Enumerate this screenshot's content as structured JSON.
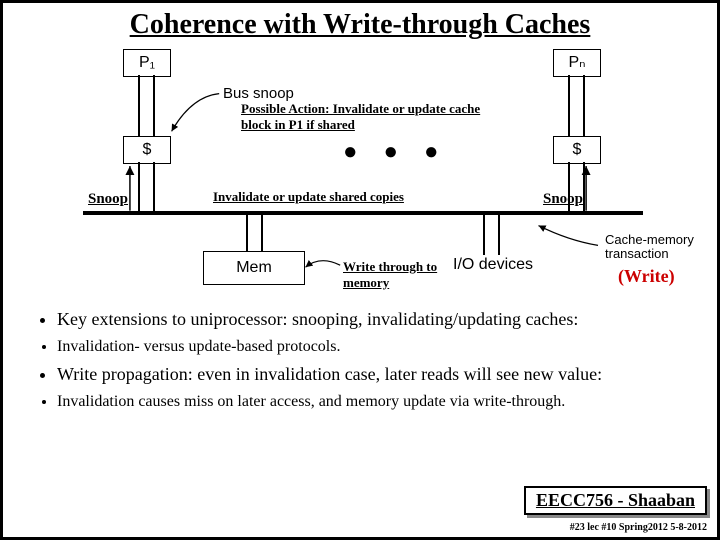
{
  "title": "Coherence with Write-through Caches",
  "diagram": {
    "p1": "P₁",
    "pn": "Pₙ",
    "cache1": "$",
    "cachen": "$",
    "mem": "Mem",
    "io": "I/O devices",
    "bus_snoop": "Bus snoop",
    "possible_action": "Possible Action: Invalidate or update cache block in P1 if shared",
    "invalidate_shared": "Invalidate or update shared copies",
    "write_through": "Write through to memory",
    "snoop1": "Snoop",
    "snoop2": "Snoop",
    "cache_mem_trans": "Cache-memory transaction",
    "write_red": "(Write)",
    "dots": "● ● ●"
  },
  "bullets": {
    "b1": "Key extensions to uniprocessor: snooping, invalidating/updating caches:",
    "b1a": "Invalidation- versus update-based protocols.",
    "b2": "Write propagation: even in invalidation case, later reads will see new value:",
    "b2a": "Invalidation causes miss on later access, and memory update via write-through."
  },
  "footer": {
    "course": "EECC756 - Shaaban",
    "meta": "#23  lec #10   Spring2012  5-8-2012"
  }
}
